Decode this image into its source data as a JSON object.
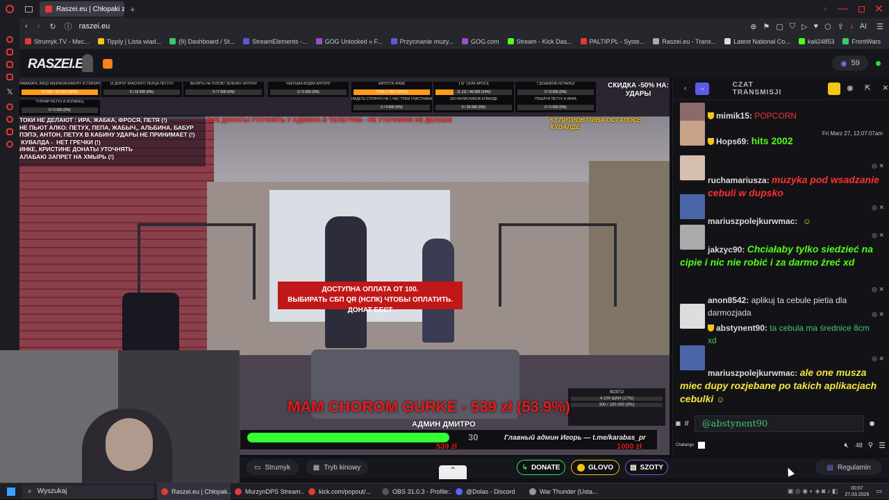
{
  "browser": {
    "active_tab": "Raszei.eu | Chłopaki z",
    "url": "raszei.eu",
    "ai_label": "AI",
    "bookmarks": [
      {
        "label": "Strumyk.TV - Mec...",
        "color": "#e53935"
      },
      {
        "label": "Tipply | Lista wiad...",
        "color": "#f5c518"
      },
      {
        "label": "(9) Dashboard / St...",
        "color": "#3ec96b"
      },
      {
        "label": "StreamElements -...",
        "color": "#5a5ad6"
      },
      {
        "label": "GOG Unlocked » F...",
        "color": "#9c4dcc"
      },
      {
        "label": "Przycinanie muzy...",
        "color": "#5a5ad6"
      },
      {
        "label": "GOG.com",
        "color": "#9c4dcc"
      },
      {
        "label": "Stream - Kick Das...",
        "color": "#53fc18"
      },
      {
        "label": "PALTIP.PL - Syste...",
        "color": "#e53935"
      },
      {
        "label": "Raszei.eu - Trans...",
        "color": "#aaaaaa"
      },
      {
        "label": "Latest National Co...",
        "color": "#dddddd"
      },
      {
        "label": "kali24853",
        "color": "#53fc18"
      },
      {
        "label": "FrontWars",
        "color": "#3ec96b"
      }
    ]
  },
  "site": {
    "logo": "RASZEI.EU",
    "viewer_count": "59"
  },
  "overlay": {
    "discount": "СКИДКА -50% НА: УДАРЫ",
    "red_banner": "ВСЕ ДОНАТЫ УТОЧНЯТЬ У АДМИНА В ТЕЛЕГРАМ - НЕ УТОЧНИЛИ НЕ ДЕЛАЕМ",
    "beer": "63 ЛИТРОВ ПИВА ОСТАЛОСЬ КУВАЛДЕ",
    "rules": [
      "ТОКИ НЕ ДЕЛАЮТ : ИРА, ЖАБКА, ФРОСЯ, ПЕТЯ (!)",
      "НЕ ПЬЮТ АЛКО: ПЕТУХ, ПЕПА, ЖАБЫЧ,, АЛЬБИНА, БАБУР",
      "ПЭПЭ, АНТОН, ПЕТУХ В КАБИНУ УДАРЫ НЕ ПРИНИМАЕТ (!)",
      " КУВАЛДА -  НЕТ ГРЕЧКИ (!)",
      "ИНКЕ, КРИСТИНЕ ДОНАТЫ УТОЧНЯТЬ",
      "АЛАБАЮ ЗАПРЕТ НА ХМЫРЬ (!)"
    ],
    "goals": [
      {
        "title": "НАМАЗАТЬ ЛИЦО МАЗИКОМ БАБУРУ И СЛИЗАТЬ КУВАЛДЕ",
        "value": "10 000 / 10 000 (100%)",
        "pct": 100
      },
      {
        "title": "ТУРНИР ПЕТУХ И ИСПАНЕЦ",
        "value": "0 / 5 000 (0%)",
        "pct": 0
      },
      {
        "title": "10 ДОРОГ КРАСНОГО ПЕРЦА ПЕТУХУ",
        "value": "0 / 15 000 (0%)",
        "pct": 0
      },
      {
        "title": "ВЫЛИТЬ НА ГОЛОВУ ЗЕЛЕНКУ АНТОНУ",
        "value": "0 / 7 000 (0%)",
        "pct": 0
      },
      {
        "title": "ЧЕКУШКА ВОДКИ АНТОНУ",
        "value": "0 / 6 000 (0%)",
        "pct": 0
      },
      {
        "title": "КАПУСТА ЖАБЕ",
        "value": "7 000 / 7 000 (100%)",
        "pct": 100
      },
      {
        "title": "НАДЕТЬ СТРИНГИ НА 1 ЧАС ТРЕМ УЧАСТНИКАМ",
        "value": "0 / 4 000 (0%)",
        "pct": 0
      },
      {
        "title": "1 КГ САЛА ФРОСЕ",
        "value": "11 111 / 46 000 (24%)",
        "pct": 24
      },
      {
        "title": "100 НАЛИСНИКОВ КУВАЛДЕ",
        "value": "0 / 30 000 (0%)",
        "pct": 0
      },
      {
        "title": "7 ДОШИКОВ ИСПАНЦУ",
        "value": "0 / 8 000 (0%)",
        "pct": 0
      },
      {
        "title": "ПОШЛУЙ ПЕТУХ И ИНКА",
        "value": "0 / 5 000 (0%)",
        "pct": 0
      }
    ],
    "payment_line1": "ДОСТУПНА ОПЛАТА ОТ 100.",
    "payment_line2": "ВЫБИРАТЬ СБП QR (НСПК) ЧТОБЫ ОПЛАТИТЬ. ДОНАТ БЕСТ",
    "alert": "MAM CHOROM GURKE - 539 zł (53.9%)",
    "admin": "АДМИН ДМИТРО",
    "progress_pct": 53.9,
    "progress_left": "539 zł",
    "progress_right": "1000 zł",
    "progress_mid": "30",
    "ticker": "Главный админ Игорь — t.me/karabas_pr",
    "side_goal_title": "ВСЕГО",
    "side_goal1": "4 100 ШАН (17%)",
    "side_goal2": "300 / 100 000 (0%)"
  },
  "chat": {
    "title": "CZAT TRANSMISJI",
    "messages": [
      {
        "user": "mimik15:",
        "text": "POPCORN",
        "color": "#e53935",
        "badge": true
      },
      {
        "user": "Hops69:",
        "text": "hits 2002",
        "color": "#53fc18",
        "badge": true,
        "time": "Fri Marz 27, 12:07:07am"
      },
      {
        "user": "ruchamariusza:",
        "text": "muzyka pod wsadzanie cebuli w dupsko",
        "color": "#ff3030",
        "badge": false
      },
      {
        "user": "mariuszpolejkurwmac:",
        "text": "",
        "color": "#ddd",
        "badge": false,
        "emoji": "☺"
      },
      {
        "user": "jakzyc90:",
        "text": "Chciałaby tylko siedzieć na cipie i nic nie robić i za darmo żreć xd",
        "color": "#53fc18",
        "badge": false
      },
      {
        "user": "anon8542:",
        "text": "aplikuj ta cebule pietia dla darmozjada",
        "color": "#ddd",
        "badge": false
      },
      {
        "user": "abstynent90:",
        "text": "ta cebula ma średnice 8cm xd",
        "color": "#3ec96b",
        "badge": true
      },
      {
        "user": "mariuszpolejkurwmac:",
        "text": "ale one musza miec dupy rozjebane po takich aplikacjach cebulki",
        "color": "#f5e642",
        "badge": false,
        "emoji": "☺"
      }
    ],
    "input_value": "@abstynent90",
    "chatango": "Chatango",
    "count": "48"
  },
  "player": {
    "strumyk": "Strumyk",
    "kino": "Tryb kinowy",
    "donate": "DONATE",
    "glovo": "GLOVO",
    "szoty": "SZOTY",
    "regulamin": "Regulamin"
  },
  "taskbar": {
    "search": "Wyszukaj",
    "items": [
      {
        "label": "Raszei.eu | Chłopak...",
        "color": "#e53935"
      },
      {
        "label": "MurzynDPS Stream...",
        "color": "#e53935"
      },
      {
        "label": "kick.com/popout/...",
        "color": "#e53935"
      },
      {
        "label": "OBS 31.0.3 - Profile:...",
        "color": "#555555"
      },
      {
        "label": "@Dolas - Discord",
        "color": "#5865f2"
      },
      {
        "label": "War Thunder (Usta...",
        "color": "#999999"
      }
    ],
    "time": "00:07",
    "date": "27.03.2026"
  }
}
